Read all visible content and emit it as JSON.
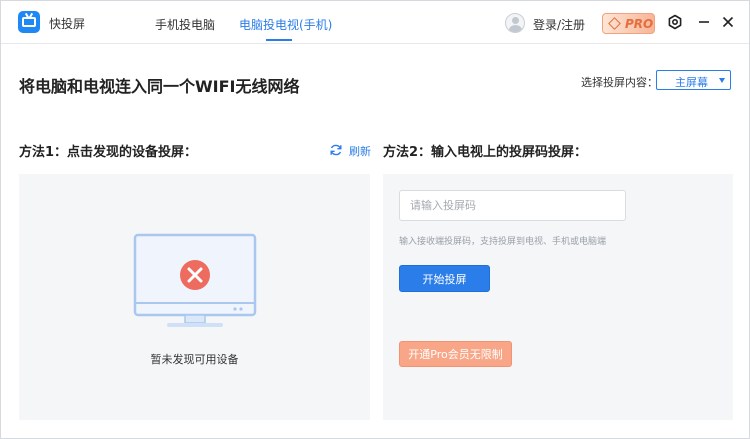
{
  "app": {
    "name": "快投屏"
  },
  "tabs": [
    {
      "label": "手机投电脑",
      "active": false
    },
    {
      "label": "电脑投电视(手机)",
      "active": true
    }
  ],
  "header": {
    "login_label": "登录/注册",
    "pro_badge": "PRO"
  },
  "main": {
    "headline": "将电脑和电视连入同一个WIFI无线网络",
    "content_select_label": "选择投屏内容：",
    "content_select_value": "主屏幕"
  },
  "method1": {
    "title": "方法1：点击发现的设备投屏：",
    "refresh_label": "刷新",
    "empty_text": "暂未发现可用设备"
  },
  "method2": {
    "title": "方法2：输入电视上的投屏码投屏：",
    "input_placeholder": "请输入投屏码",
    "input_value": "",
    "hint": "输入接收端投屏码，支持投屏到电视、手机或电脑端",
    "start_button": "开始投屏",
    "pro_button": "开通Pro会员无限制"
  },
  "colors": {
    "accent": "#2b7de9",
    "pro_accent": "#f8a687",
    "error": "#ee6b5f"
  },
  "icons": {
    "logo": "tv-icon",
    "refresh": "refresh-icon",
    "settings": "settings-icon",
    "minimize": "minimize-icon",
    "close": "close-icon"
  }
}
